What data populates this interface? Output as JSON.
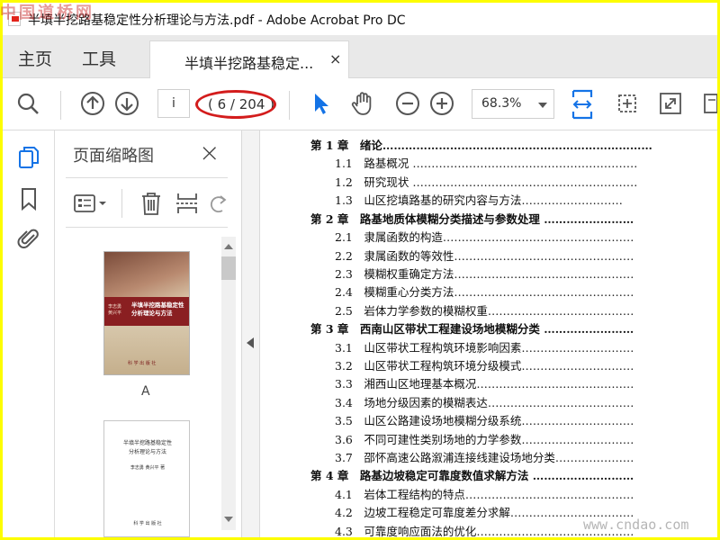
{
  "window": {
    "title": "半填半挖路基稳定性分析理论与方法.pdf - Adobe Acrobat Pro DC",
    "watermark_top": "中国道桥网",
    "watermark_bottom": "www.cndao.com"
  },
  "tabs": {
    "home": "主页",
    "tools": "工具",
    "document": "半填半挖路基稳定...",
    "close": "×"
  },
  "toolbar": {
    "page_input": "i",
    "page_count": "( 6 / 204 )",
    "zoom": "68.3%",
    "accent_color": "#1473e6",
    "annotation_color": "#d31c1c"
  },
  "thumbnails": {
    "title": "页面缩略图",
    "close": "×",
    "cover_title_line1": "半填半挖路基稳定性",
    "cover_title_line2": "分析理论与方法",
    "cover_authors_line1": "李志勇",
    "cover_authors_line2": "黄兴平",
    "cover_publisher": "科 学 出 版 社",
    "page1_label": "A",
    "page2_title_line1": "半填半挖路基稳定性",
    "page2_title_line2": "分析理论与方法",
    "page2_authors": "李志勇  黄兴平  著",
    "page2_publisher": "科 学 出 版 社"
  },
  "toc": [
    {
      "level": "chapter",
      "text": "第 1 章　绪论………………………………………………………………"
    },
    {
      "level": "section",
      "text": "1.1　路基概况 ……………………………………………………"
    },
    {
      "level": "section",
      "text": "1.2　研究现状 ……………………………………………………"
    },
    {
      "level": "section",
      "text": "1.3　山区挖填路基的研究内容与方法………………………"
    },
    {
      "level": "chapter",
      "text": "第 2 章　路基地质体模糊分类描述与参数处理 ……………………"
    },
    {
      "level": "section",
      "text": "2.1　隶属函数的构造……………………………………………"
    },
    {
      "level": "section",
      "text": "2.2　隶属函数的等效性…………………………………………"
    },
    {
      "level": "section",
      "text": "2.3　模糊权重确定方法…………………………………………"
    },
    {
      "level": "section",
      "text": "2.4　模糊重心分类方法…………………………………………"
    },
    {
      "level": "section",
      "text": "2.5　岩体力学参数的模糊权重…………………………………"
    },
    {
      "level": "chapter",
      "text": "第 3 章　西南山区带状工程建设场地模糊分类 ……………………"
    },
    {
      "level": "section",
      "text": "3.1　山区带状工程构筑环境影响因素…………………………"
    },
    {
      "level": "section",
      "text": "3.2　山区带状工程构筑环境分级模式…………………………"
    },
    {
      "level": "section",
      "text": "3.3　湘西山区地理基本概况……………………………………"
    },
    {
      "level": "section",
      "text": "3.4　场地分级因素的模糊表达…………………………………"
    },
    {
      "level": "section",
      "text": "3.5　山区公路建设场地模糊分级系统…………………………"
    },
    {
      "level": "section",
      "text": "3.6　不同可建性类别场地的力学参数…………………………"
    },
    {
      "level": "section",
      "text": "3.7　邵怀高速公路溆浦连接线建设场地分类…………………"
    },
    {
      "level": "chapter",
      "text": "第 4 章　路基边坡稳定可靠度数值求解方法 ………………………"
    },
    {
      "level": "section",
      "text": "4.1　岩体工程结构的特点………………………………………"
    },
    {
      "level": "section",
      "text": "4.2　边坡工程稳定可靠度差分求解……………………………"
    },
    {
      "level": "section",
      "text": "4.3　可靠度响应面法的优化……………………………………"
    }
  ]
}
